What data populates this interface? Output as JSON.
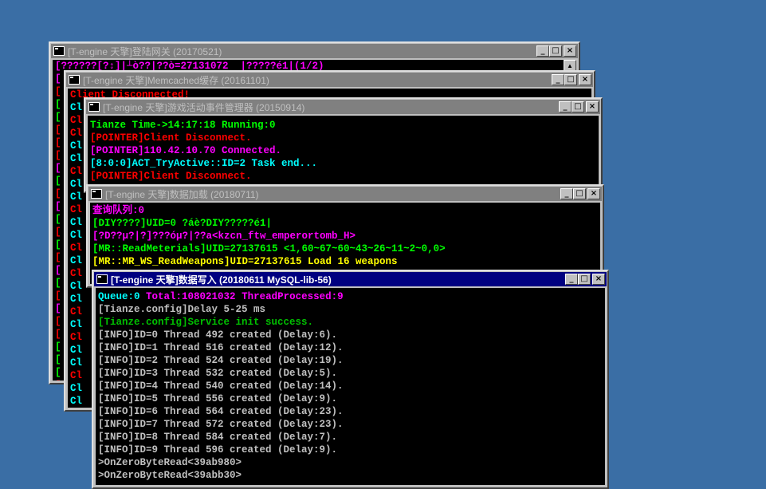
{
  "windows": {
    "gateway": {
      "title": "[T-engine 天擎]登陆网关 (20170521)",
      "lines": [
        {
          "text": "[??????[?↕]|┴ò??|??ò=27131072  |?????é1|(1/2)",
          "color": "magenta"
        }
      ],
      "left_column": [
        "[",
        "[",
        "[",
        "[",
        "[",
        "[",
        "[",
        "[",
        "[",
        "[",
        "[",
        "[",
        "[",
        "[",
        "[",
        "[",
        "[",
        "[",
        "[",
        "[",
        "[",
        "[",
        "[",
        "[",
        "["
      ],
      "left_colors": [
        "magenta",
        "red",
        "green",
        "green",
        "red",
        "red",
        "red",
        "magenta",
        "green",
        "red",
        "magenta",
        "green",
        "red",
        "green",
        "red",
        "magenta",
        "green",
        "red",
        "magenta",
        "red",
        "red",
        "green",
        "green",
        "green",
        "red"
      ]
    },
    "memcached": {
      "title": "[T-engine 天擎]Memcached缓存 (20161101)",
      "lines": [
        {
          "text": "Client Disconnected!",
          "color": "red"
        }
      ],
      "left_column": [
        "Cl",
        "Cl",
        "Cl",
        "Cl",
        "Cl",
        "Cl",
        "Cl",
        "Cl",
        "Cl",
        "Cl",
        "Cl",
        "Cl",
        "Cl",
        "Cl",
        "Cl",
        "Cl",
        "Cl",
        "Cl",
        "Cl",
        "Cl",
        "Cl",
        "Cl",
        "Cl",
        "Cl"
      ],
      "left_colors": [
        "cyan",
        "red",
        "red",
        "cyan",
        "cyan",
        "red",
        "cyan",
        "cyan",
        "red",
        "cyan",
        "cyan",
        "red",
        "cyan",
        "red",
        "cyan",
        "cyan",
        "red",
        "cyan",
        "red",
        "cyan",
        "cyan",
        "red",
        "cyan",
        "cyan"
      ]
    },
    "activity": {
      "title": "[T-engine 天擎]游戏活动事件管理器 (20150914)",
      "lines": [
        {
          "text": "Tianze Time->14:17:18 Running:0",
          "color": "green"
        },
        {
          "text": "[POINTER]Client Disconnect.",
          "color": "red"
        },
        {
          "text": "[POINTER]110.42.10.70 Connected.",
          "color": "magenta"
        },
        {
          "text": "[8:0:0]ACT_TryActive::ID=2 Task end...",
          "color": "cyan"
        },
        {
          "text": "[POINTER]Client Disconnect.",
          "color": "red"
        }
      ]
    },
    "dataload": {
      "title": "[T-engine 天擎]数据加载 (20180711)",
      "lines": [
        {
          "text": "查询队列:0",
          "color": "magenta"
        },
        {
          "text": "[DIY????]UID=0 ?áè?DIY?????é1|",
          "color": "green"
        },
        {
          "text": "[?D??μ?|?]???óμ?|??a<kzcn_ftw_emperortomb_H>",
          "color": "magenta"
        },
        {
          "text": "[MR::ReadMeterials]UID=27137615 <1,60~67~60~43~26~11~2~0,0>",
          "color": "green"
        },
        {
          "text": "[MR::MR_WS_ReadWeapons]UID=27137615 Load 16 weapons",
          "color": "yellow"
        }
      ]
    },
    "datawrite": {
      "title": "[T-engine 天擎]数据写入 (20180611 MySQL-lib-56)",
      "header": {
        "queue": "Queue:0",
        "total": "Total:108021032",
        "thread": "ThreadProcessed:9"
      },
      "lines": [
        {
          "text": "[Tianze.config]Delay 5-25 ms",
          "color": "white"
        },
        {
          "text": "[Tianze.config]Service init success.",
          "color": "dgreen"
        },
        {
          "text": "[INFO]ID=0 Thread 492 created (Delay:6).",
          "color": "white"
        },
        {
          "text": "[INFO]ID=1 Thread 516 created (Delay:12).",
          "color": "white"
        },
        {
          "text": "[INFO]ID=2 Thread 524 created (Delay:19).",
          "color": "white"
        },
        {
          "text": "[INFO]ID=3 Thread 532 created (Delay:5).",
          "color": "white"
        },
        {
          "text": "[INFO]ID=4 Thread 540 created (Delay:14).",
          "color": "white"
        },
        {
          "text": "[INFO]ID=5 Thread 556 created (Delay:9).",
          "color": "white"
        },
        {
          "text": "[INFO]ID=6 Thread 564 created (Delay:23).",
          "color": "white"
        },
        {
          "text": "[INFO]ID=7 Thread 572 created (Delay:23).",
          "color": "white"
        },
        {
          "text": "[INFO]ID=8 Thread 584 created (Delay:7).",
          "color": "white"
        },
        {
          "text": "[INFO]ID=9 Thread 596 created (Delay:9).",
          "color": "white"
        },
        {
          "text": ">OnZeroByteRead<39ab980>",
          "color": "white"
        },
        {
          "text": ">OnZeroByteRead<39abb30>",
          "color": "white"
        }
      ]
    }
  },
  "buttons": {
    "minimize": "_",
    "maximize": "□",
    "close": "×"
  },
  "colors": {
    "desktop": "#3a6ea5",
    "active_title": "#000080",
    "inactive_title": "#808080"
  }
}
